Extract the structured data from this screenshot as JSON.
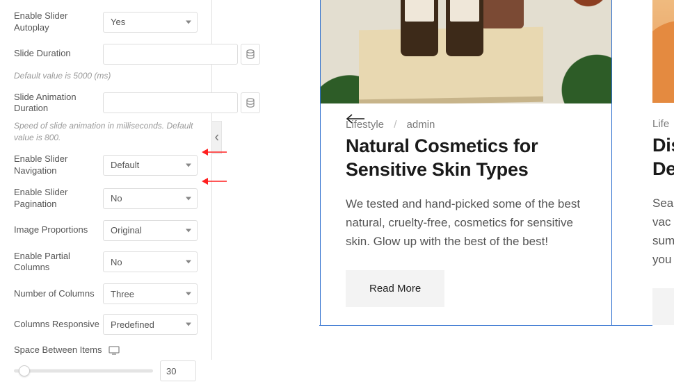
{
  "panel": {
    "autoplay": {
      "label": "Enable Slider Autoplay",
      "value": "Yes"
    },
    "slide_duration": {
      "label": "Slide Duration",
      "value": "",
      "hint": "Default value is 5000 (ms)"
    },
    "anim_duration": {
      "label": "Slide Animation Duration",
      "value": "",
      "hint": "Speed of slide animation in milliseconds. Default value is 800."
    },
    "navigation": {
      "label": "Enable Slider Navigation",
      "value": "Default"
    },
    "pagination": {
      "label": "Enable Slider Pagination",
      "value": "No"
    },
    "proportions": {
      "label": "Image Proportions",
      "value": "Original"
    },
    "partial_cols": {
      "label": "Enable Partial Columns",
      "value": "No"
    },
    "num_cols": {
      "label": "Number of Columns",
      "value": "Three"
    },
    "cols_responsive": {
      "label": "Columns Responsive",
      "value": "Predefined"
    },
    "space": {
      "label": "Space Between Items",
      "value": "30"
    }
  },
  "preview": {
    "post1": {
      "category": "Lifestyle",
      "author": "admin",
      "title": "Natural Cosmetics for Sensitive Skin Types",
      "excerpt": "We tested and hand-picked some of the best natural, cruelty-free, cosmetics for sensitive skin. Glow up with the best of the best!",
      "readmore": "Read More"
    },
    "post2": {
      "category": "Life",
      "title_l1": "Dis",
      "title_l2": "Des",
      "excerpt_l1": "Sea",
      "excerpt_l2": "vac",
      "excerpt_l3": "sum",
      "excerpt_l4": "you"
    }
  }
}
